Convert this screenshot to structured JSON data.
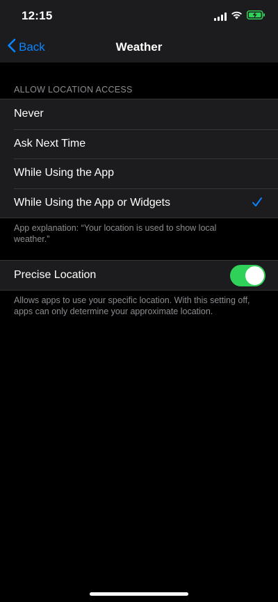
{
  "status_bar": {
    "time": "12:15",
    "icons": [
      "signal-icon",
      "wifi-icon",
      "battery-charging-icon"
    ],
    "battery_color": "#30d158"
  },
  "nav": {
    "back_label": "Back",
    "title": "Weather",
    "accent_color": "#0a84ff"
  },
  "location_access": {
    "header": "ALLOW LOCATION ACCESS",
    "options": [
      {
        "label": "Never",
        "selected": false
      },
      {
        "label": "Ask Next Time",
        "selected": false
      },
      {
        "label": "While Using the App",
        "selected": false
      },
      {
        "label": "While Using the App or Widgets",
        "selected": true
      }
    ],
    "explanation": "App explanation: “Your location is used to show local weather.”"
  },
  "precise_location": {
    "label": "Precise Location",
    "enabled": true,
    "toggle_color": "#30d158",
    "description": "Allows apps to use your specific location. With this setting off, apps can only determine your approximate location."
  }
}
